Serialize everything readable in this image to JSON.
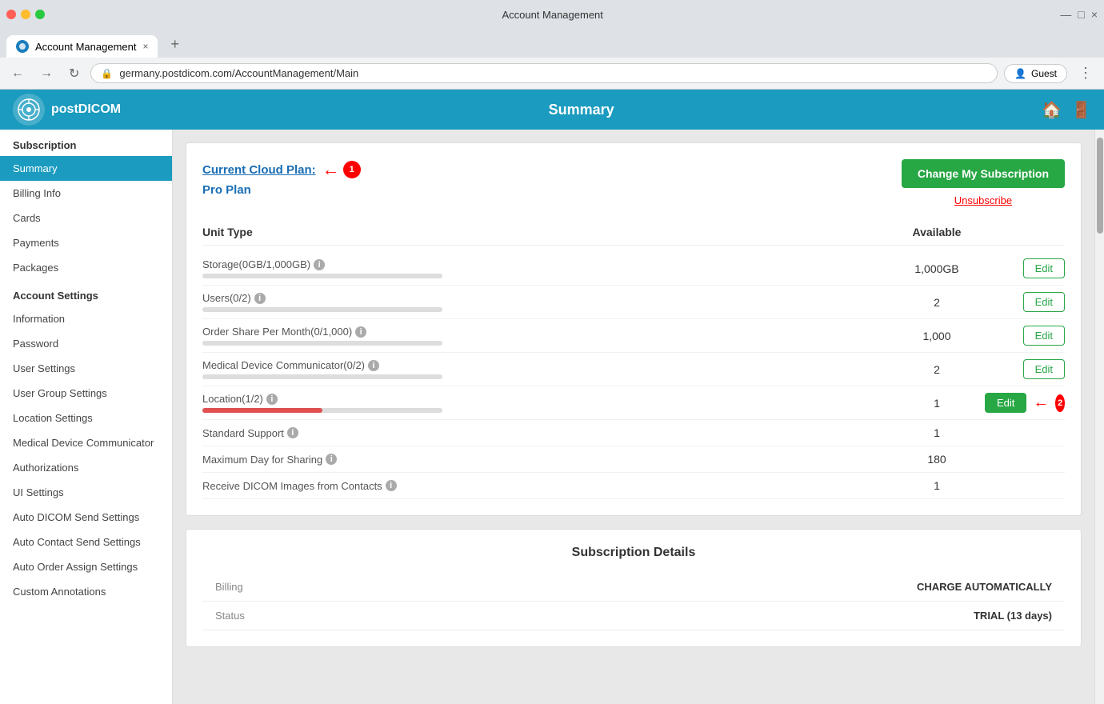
{
  "browser": {
    "tab_label": "Account Management",
    "address": "germany.postdicom.com/AccountManagement/Main",
    "tab_close": "×",
    "tab_new": "+",
    "back_icon": "←",
    "forward_icon": "→",
    "refresh_icon": "↻",
    "menu_icon": "⋮",
    "guest_label": "Guest",
    "window_minimize": "—",
    "window_maximize": "□",
    "window_close": "×"
  },
  "app": {
    "logo_text": "postDICOM",
    "header_title": "Summary",
    "header_icon1": "🏠",
    "header_icon2": "🚪"
  },
  "sidebar": {
    "subscription_label": "Subscription",
    "items_subscription": [
      {
        "id": "summary",
        "label": "Summary",
        "active": true
      },
      {
        "id": "billing-info",
        "label": "Billing Info",
        "active": false
      },
      {
        "id": "cards",
        "label": "Cards",
        "active": false
      },
      {
        "id": "payments",
        "label": "Payments",
        "active": false
      },
      {
        "id": "packages",
        "label": "Packages",
        "active": false
      }
    ],
    "account_settings_label": "Account Settings",
    "items_account": [
      {
        "id": "information",
        "label": "Information",
        "active": false
      },
      {
        "id": "password",
        "label": "Password",
        "active": false
      },
      {
        "id": "user-settings",
        "label": "User Settings",
        "active": false
      },
      {
        "id": "user-group-settings",
        "label": "User Group Settings",
        "active": false
      },
      {
        "id": "location-settings",
        "label": "Location Settings",
        "active": false
      },
      {
        "id": "medical-device",
        "label": "Medical Device Communicator",
        "active": false
      },
      {
        "id": "authorizations",
        "label": "Authorizations",
        "active": false
      },
      {
        "id": "ui-settings",
        "label": "UI Settings",
        "active": false
      },
      {
        "id": "auto-dicom",
        "label": "Auto DICOM Send Settings",
        "active": false
      },
      {
        "id": "auto-contact",
        "label": "Auto Contact Send Settings",
        "active": false
      },
      {
        "id": "auto-order",
        "label": "Auto Order Assign Settings",
        "active": false
      },
      {
        "id": "custom-annotations",
        "label": "Custom Annotations",
        "active": false
      }
    ]
  },
  "main": {
    "current_plan_link": "Current Cloud Plan:",
    "plan_name": "Pro Plan",
    "change_btn": "Change My Subscription",
    "unsubscribe_link": "Unsubscribe",
    "col_unit_type": "Unit Type",
    "col_available": "Available",
    "units": [
      {
        "name": "Storage(0GB/1,000GB)",
        "has_info": true,
        "progress": 0,
        "progress_color": "#ccc",
        "value": "1,000GB",
        "edit_label": "Edit",
        "edit_active": false
      },
      {
        "name": "Users(0/2)",
        "has_info": true,
        "progress": 0,
        "progress_color": "#ccc",
        "value": "2",
        "edit_label": "Edit",
        "edit_active": false
      },
      {
        "name": "Order Share Per Month(0/1,000)",
        "has_info": true,
        "progress": 0,
        "progress_color": "#ccc",
        "value": "1,000",
        "edit_label": "Edit",
        "edit_active": false
      },
      {
        "name": "Medical Device Communicator(0/2)",
        "has_info": true,
        "progress": 0,
        "progress_color": "#ccc",
        "value": "2",
        "edit_label": "Edit",
        "edit_active": false
      },
      {
        "name": "Location(1/2)",
        "has_info": true,
        "progress": 50,
        "progress_color": "#e05050",
        "value": "1",
        "edit_label": "Edit",
        "edit_active": true
      },
      {
        "name": "Standard Support",
        "has_info": true,
        "progress": -1,
        "value": "1",
        "edit_label": "",
        "edit_active": false
      },
      {
        "name": "Maximum Day for Sharing",
        "has_info": true,
        "progress": -1,
        "value": "180",
        "edit_label": "",
        "edit_active": false
      },
      {
        "name": "Receive DICOM Images from Contacts",
        "has_info": true,
        "progress": -1,
        "value": "1",
        "edit_label": "",
        "edit_active": false
      }
    ],
    "subscription_details_title": "Subscription Details",
    "billing_label": "Billing",
    "billing_value": "CHARGE AUTOMATICALLY",
    "status_label": "Status",
    "status_value": "TRIAL (13 days)"
  },
  "annotations": {
    "arrow1_num": "1",
    "arrow2_num": "2"
  }
}
